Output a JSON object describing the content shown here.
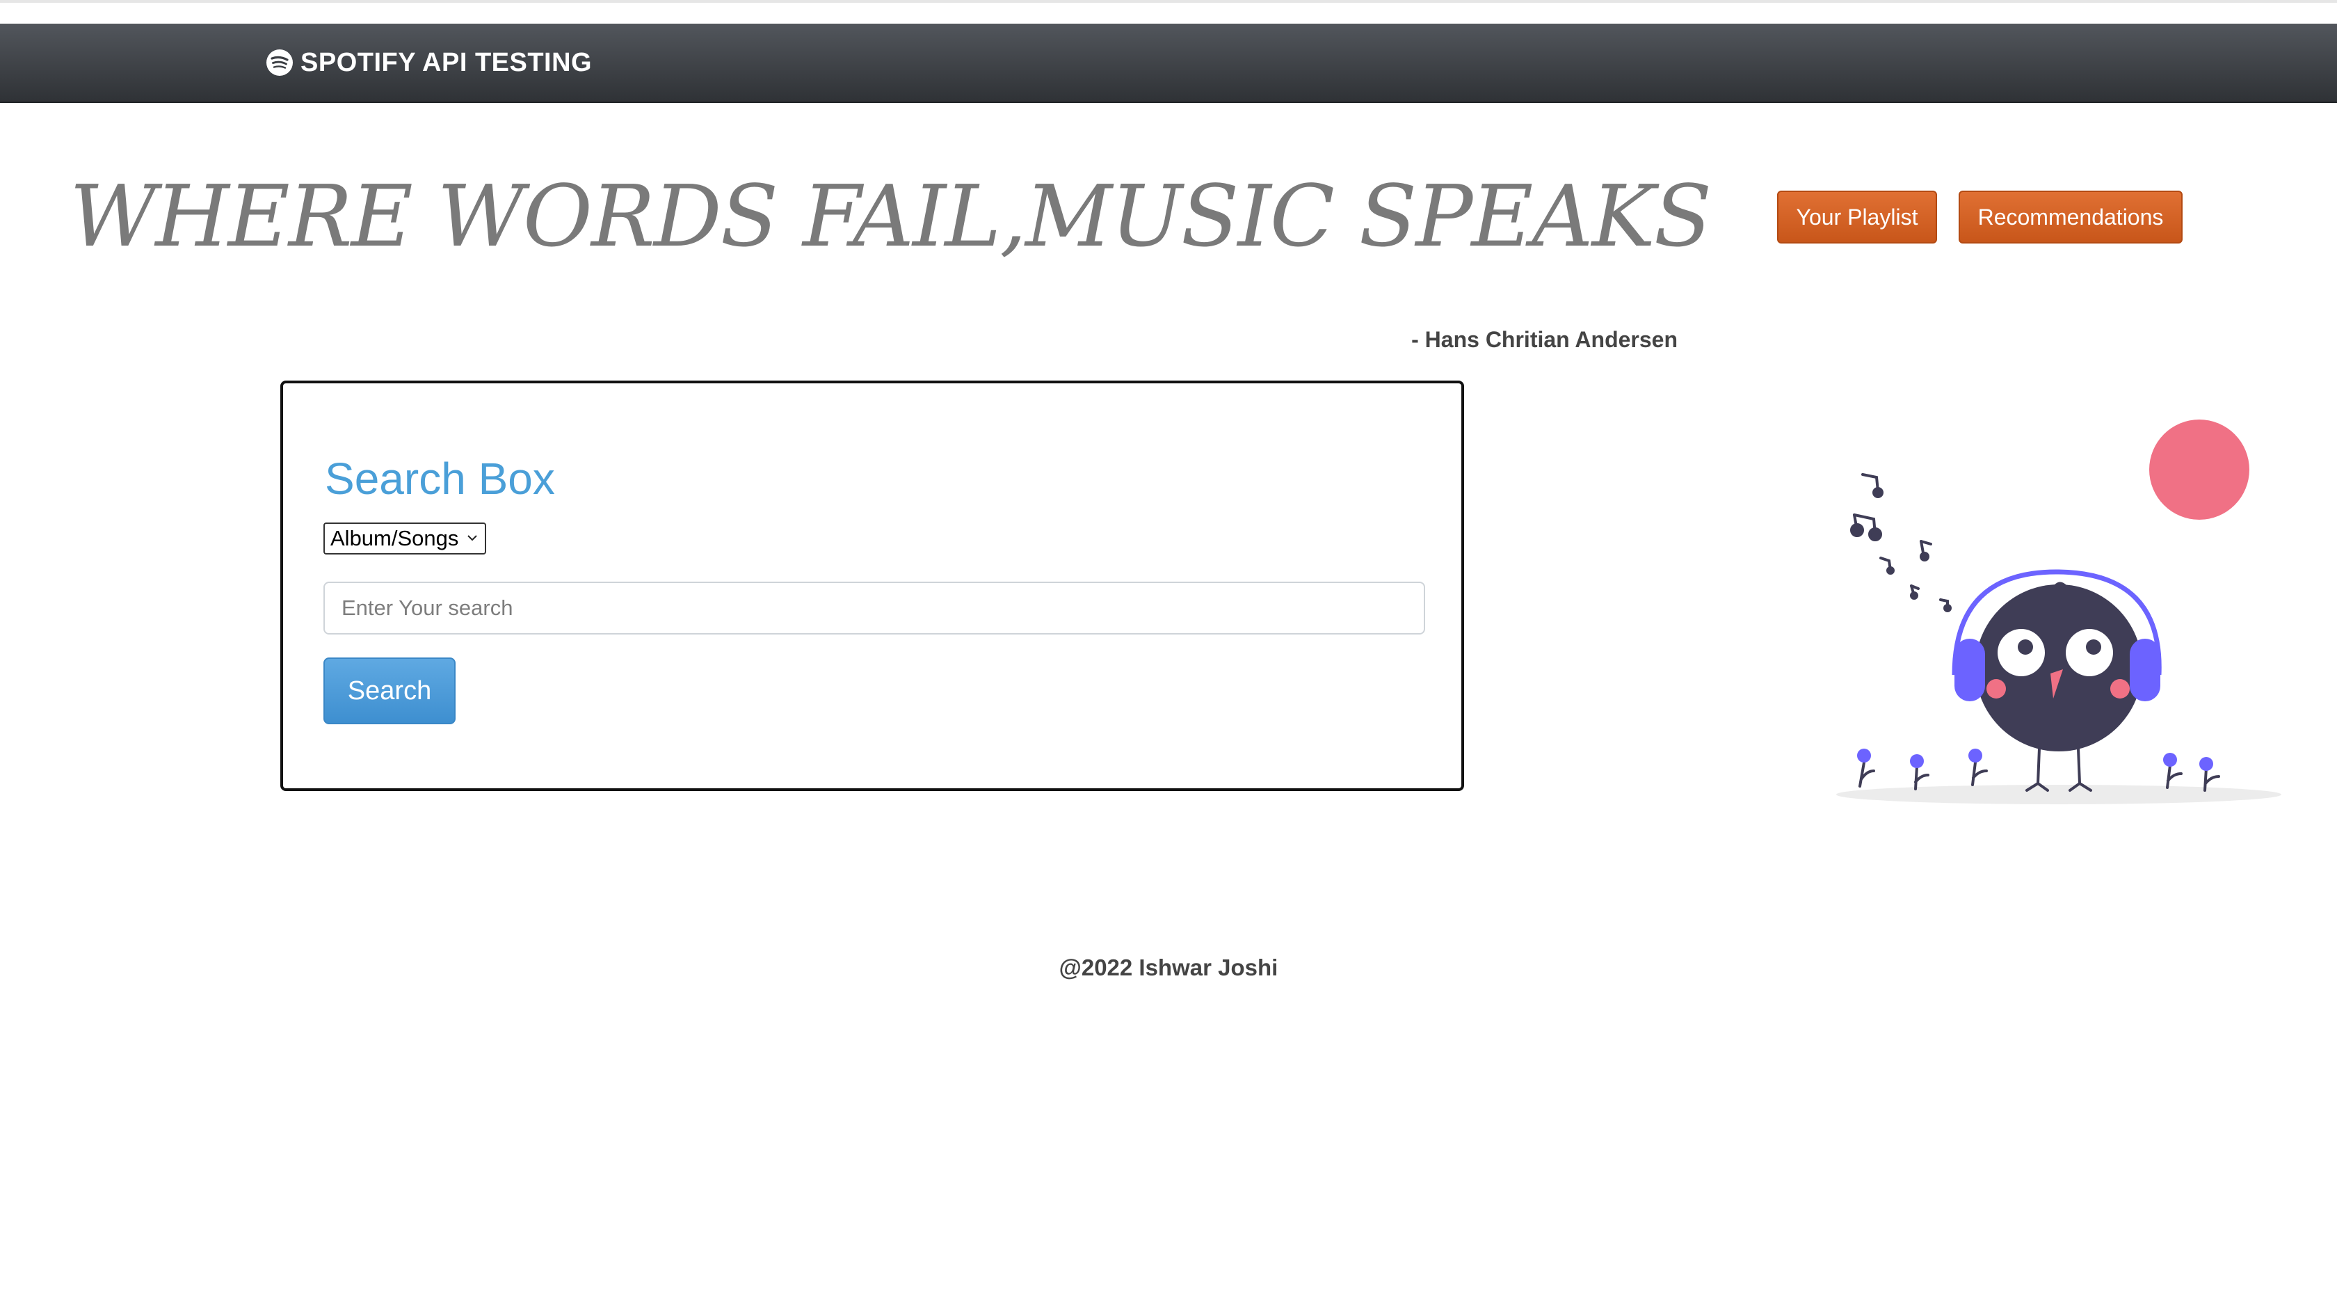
{
  "navbar": {
    "brand_label": "SPOTIFY API TESTING",
    "brand_icon": "spotify-icon"
  },
  "hero": {
    "quote": "WHERE WORDS FAIL,MUSIC SPEAKS",
    "author": "- Hans Chritian Andersen"
  },
  "actions": {
    "playlist_label": "Your Playlist",
    "recommendations_label": "Recommendations"
  },
  "search": {
    "title": "Search Box",
    "type_selected": "Album/Songs",
    "placeholder": "Enter Your search",
    "button_label": "Search"
  },
  "footer": {
    "copyright": "@2022 Ishwar Joshi"
  },
  "colors": {
    "navbar_bg": "#3a3d42",
    "accent_orange": "#d25f22",
    "accent_blue": "#4a9fd8",
    "illustration_purple": "#6c63ff",
    "illustration_pink": "#f07185"
  }
}
